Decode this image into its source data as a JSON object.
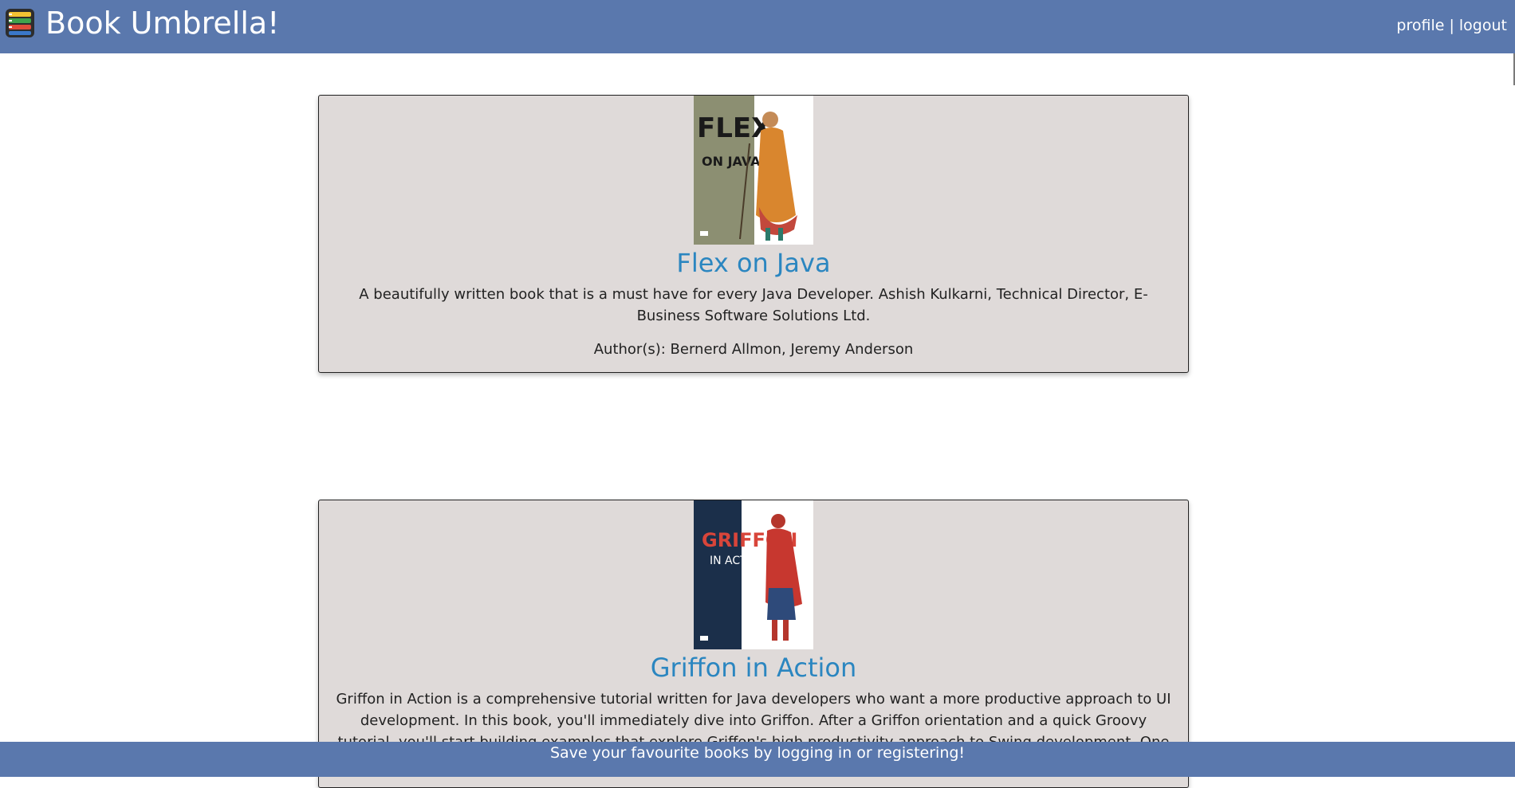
{
  "header": {
    "brand": "Book Umbrella!",
    "nav": {
      "profile": "profile",
      "separator": " | ",
      "logout": "logout"
    }
  },
  "books": [
    {
      "title": "Flex on Java",
      "description": "A beautifully written book that is a must have for every Java Developer. Ashish Kulkarni, Technical Director, E-Business Software Solutions Ltd.",
      "authors": "Author(s): Bernerd Allmon, Jeremy Anderson",
      "cover": {
        "title_line1": "FLEX",
        "title_line2": "ON JAVA",
        "spine_color": "#8c8f72"
      }
    },
    {
      "title": "Griffon in Action",
      "description": "Griffon in Action is a comprehensive tutorial written for Java developers who want a more productive approach to UI development. In this book, you'll immediately dive into Griffon. After a Griffon orientation and a quick Groovy tutorial, you'll start building examples that explore Griffon's high productivity approach to Swing development. One of the troublesome",
      "authors": "",
      "cover": {
        "title_line1": "GRIFFON",
        "title_line2": "IN ACTION",
        "spine_color": "#1b2f4a"
      }
    }
  ],
  "footer": {
    "message": "Save your favourite books by logging in or registering!"
  },
  "colors": {
    "header_bg": "#5a78ad",
    "card_bg": "#dfdad9",
    "title_link": "#2b86c0"
  }
}
